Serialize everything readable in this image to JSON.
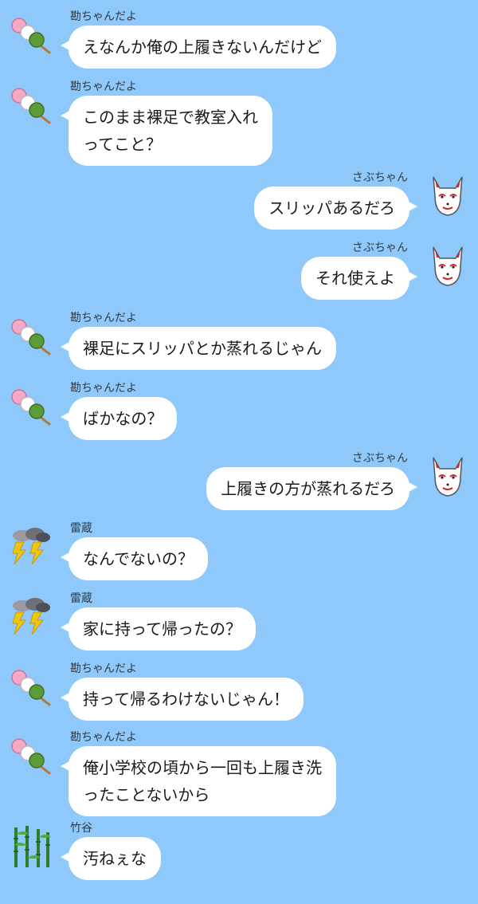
{
  "chat": {
    "messages": [
      {
        "side": "left",
        "sender": "勘ちゃんだよ",
        "avatar": "dango-icon",
        "lines": [
          "えなんか俺の上履きないんだけど"
        ]
      },
      {
        "side": "left",
        "sender": "勘ちゃんだよ",
        "avatar": "dango-icon",
        "lines": [
          "このまま裸足で教室入れ",
          "ってこと？"
        ]
      },
      {
        "side": "right",
        "sender": "さぶちゃん",
        "avatar": "fox-mask-icon",
        "lines": [
          "スリッパあるだろ"
        ]
      },
      {
        "side": "right",
        "sender": "さぶちゃん",
        "avatar": "fox-mask-icon",
        "lines": [
          "それ使えよ"
        ]
      },
      {
        "side": "left",
        "sender": "勘ちゃんだよ",
        "avatar": "dango-icon",
        "lines": [
          "裸足にスリッパとか蒸れるじゃん"
        ]
      },
      {
        "side": "left",
        "sender": "勘ちゃんだよ",
        "avatar": "dango-icon",
        "lines": [
          "ばかなの？"
        ]
      },
      {
        "side": "right",
        "sender": "さぶちゃん",
        "avatar": "fox-mask-icon",
        "lines": [
          "上履きの方が蒸れるだろ"
        ]
      },
      {
        "side": "left",
        "sender": "雷蔵",
        "avatar": "thunder-cloud-icon",
        "lines": [
          "なんでないの？"
        ]
      },
      {
        "side": "left",
        "sender": "雷蔵",
        "avatar": "thunder-cloud-icon",
        "lines": [
          "家に持って帰ったの？"
        ]
      },
      {
        "side": "left",
        "sender": "勘ちゃんだよ",
        "avatar": "dango-icon",
        "lines": [
          "持って帰るわけないじゃん！"
        ]
      },
      {
        "side": "left",
        "sender": "勘ちゃんだよ",
        "avatar": "dango-icon",
        "lines": [
          "俺小学校の頃から一回も上履き洗",
          "ったことないから"
        ]
      },
      {
        "side": "left",
        "sender": "竹谷",
        "avatar": "bamboo-icon",
        "lines": [
          "汚ねぇな"
        ]
      }
    ]
  },
  "colors": {
    "background": "#8fc9fb",
    "bubble": "#ffffff",
    "text": "#1a1a1a"
  }
}
